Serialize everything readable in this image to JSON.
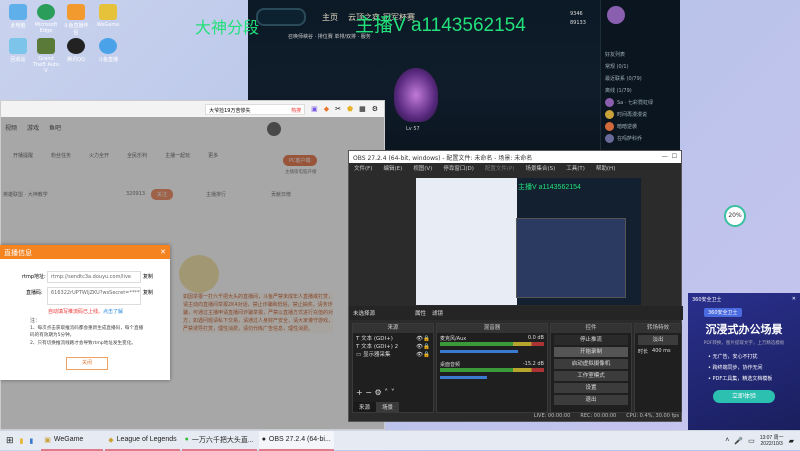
{
  "desktop": {
    "icons": [
      "此电脑",
      "Microsoft Edge",
      "斗鱼直播伴侣",
      "WeGame",
      "回收站",
      "Grand Theft Auto V",
      "腾讯QQ",
      "斗鱼直播"
    ]
  },
  "watermark": {
    "rank": "大神分段",
    "contact": "主播V a1143562154"
  },
  "lol": {
    "nav": [
      "主页",
      "云顶之弈",
      "冠军杯赛"
    ],
    "mode": "召唤师峡谷 · 排位赛 单排/双排 · 服务",
    "currency": [
      "9346",
      "89133"
    ],
    "player": "Lv 57",
    "social_header": "好友列表",
    "groups": [
      "常规 (0/1)",
      "最近联系 (0/79)",
      "离线 (1/79)"
    ],
    "friends": [
      "Sa · 七彩霓虹绿",
      "时间再漫漫说",
      "暗暗逆袭",
      "在吗萨科乔"
    ]
  },
  "browser": {
    "search": "大爷捡19万苦惨失",
    "hot": "热搜",
    "nav": [
      "视频",
      "游戏",
      "鱼吧"
    ],
    "toolbar": [
      "开播提醒",
      "",
      "粉丝任务",
      "火力全开",
      "全民乐判",
      "主播一起玩",
      "更多"
    ],
    "pc_button": "PC客户端",
    "pc_sub": "主播版电脑开播",
    "room": "英雄联盟 · 大神教学",
    "followers": "320913",
    "follow": "关注",
    "rank_tabs": [
      "主播排行",
      "贡献日榜"
    ],
    "notice": "如因举报一打六千把大头的直播间，斗鱼严禁未成年人直播或打赏，请主动向直播间举报2K4对话，禁止诈骗和低俗，禁止抽奖，请务诈骗，可通过主播申请直播间诈骗举报，严禁以直播方式进行充值的对方，如遇问题请私下交易，请通过人身财产安全，请大家遵守游戏，严禁诱导打赏，理性消费，请勿代练广告信息，理性消费。"
  },
  "modal": {
    "title": "直播信息",
    "rtmp_label": "rtmp地址:",
    "rtmp_value": "rtmp://sendtc3a.douyu.com/live",
    "key_label": "直播码:",
    "key_value": "616322rUPTWljZKU?wsSecret=**********",
    "copy": "复制",
    "warning": "自动填写推流码已上线。",
    "learn_more": "点击了解",
    "note_title": "注：",
    "notes": [
      "1、每次点击获取推流码都会重新生成直播码，每个直播码的有效期为5分钟。",
      "2、只有切换推流线路才会导致rtmp地址发生变化。"
    ],
    "close": "关闭"
  },
  "obs": {
    "title": "OBS 27.2.4 (64-bit, windows) - 配置文件: 未命名 - 场景: 未命名",
    "menu": [
      "文件(F)",
      "编辑(E)",
      "视图(V)",
      "停靠窗口(D)",
      "配置文件(P)",
      "场景集合(S)",
      "工具(T)",
      "帮助(H)"
    ],
    "no_source": "未选择源",
    "props": "属性",
    "filters": "滤镜",
    "sources_title": "来源",
    "sources": [
      "文本 (GDI+)",
      "文本 (GDI+) 2",
      "显示器采集"
    ],
    "mixer_title": "混音器",
    "mixer": [
      {
        "name": "麦克风/Aux",
        "db": "0.0 dB",
        "level": 1.0
      },
      {
        "name": "桌面音频",
        "db": "-15.2 dB",
        "level": 0.6
      }
    ],
    "controls_title": "控件",
    "controls": [
      "停止推流",
      "开始录制",
      "启动虚拟摄像机",
      "工作室模式",
      "设置",
      "退出"
    ],
    "transition_title": "转场特效",
    "transition": "淡出",
    "duration_label": "时长",
    "duration": "400 ms",
    "tabs": [
      "来源",
      "场景"
    ],
    "status": {
      "live": "LIVE: 00:00:00",
      "rec": "REC: 00:00:00",
      "cpu": "CPU: 0.4%, 30.00 fps"
    },
    "preview_watermark": "主播V a1143562154"
  },
  "ad": {
    "brand": "360安全卫士",
    "badge": "360安全卫士",
    "title": "沉浸式办公场景",
    "sub": "PDF转换，图片提取文字，上万精选模板",
    "points": [
      "无广告，安心不打扰",
      "跨终端同步，协作无间",
      "PDF工具集，精选文档模板"
    ],
    "cta": "立即体验"
  },
  "battery": "20%",
  "taskbar": {
    "apps": [
      "WeGame",
      "League of Legends",
      "一万六千把大头直...",
      "OBS 27.2.4 (64-bi..."
    ],
    "time": "13:07 周一",
    "date": "2022/10/3"
  }
}
